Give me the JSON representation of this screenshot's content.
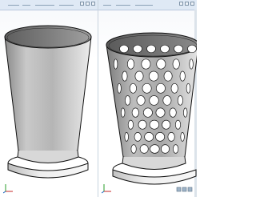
{
  "left_window": {
    "title": "",
    "model": "solid-cup",
    "triad_icon": "axis-triad-icon"
  },
  "right_window": {
    "title": "",
    "model": "perforated-basket",
    "triad_icon": "axis-triad-icon",
    "status_icon": "view-orientation-icon"
  },
  "colors": {
    "model_light": "#f2f2f2",
    "model_mid": "#bdbdbd",
    "model_dark": "#777777",
    "edge": "#111111",
    "window_border": "#c8d3de",
    "titlebar": "#dfe9f5"
  },
  "perforation": {
    "rows": 8,
    "columns_visible": 5
  }
}
